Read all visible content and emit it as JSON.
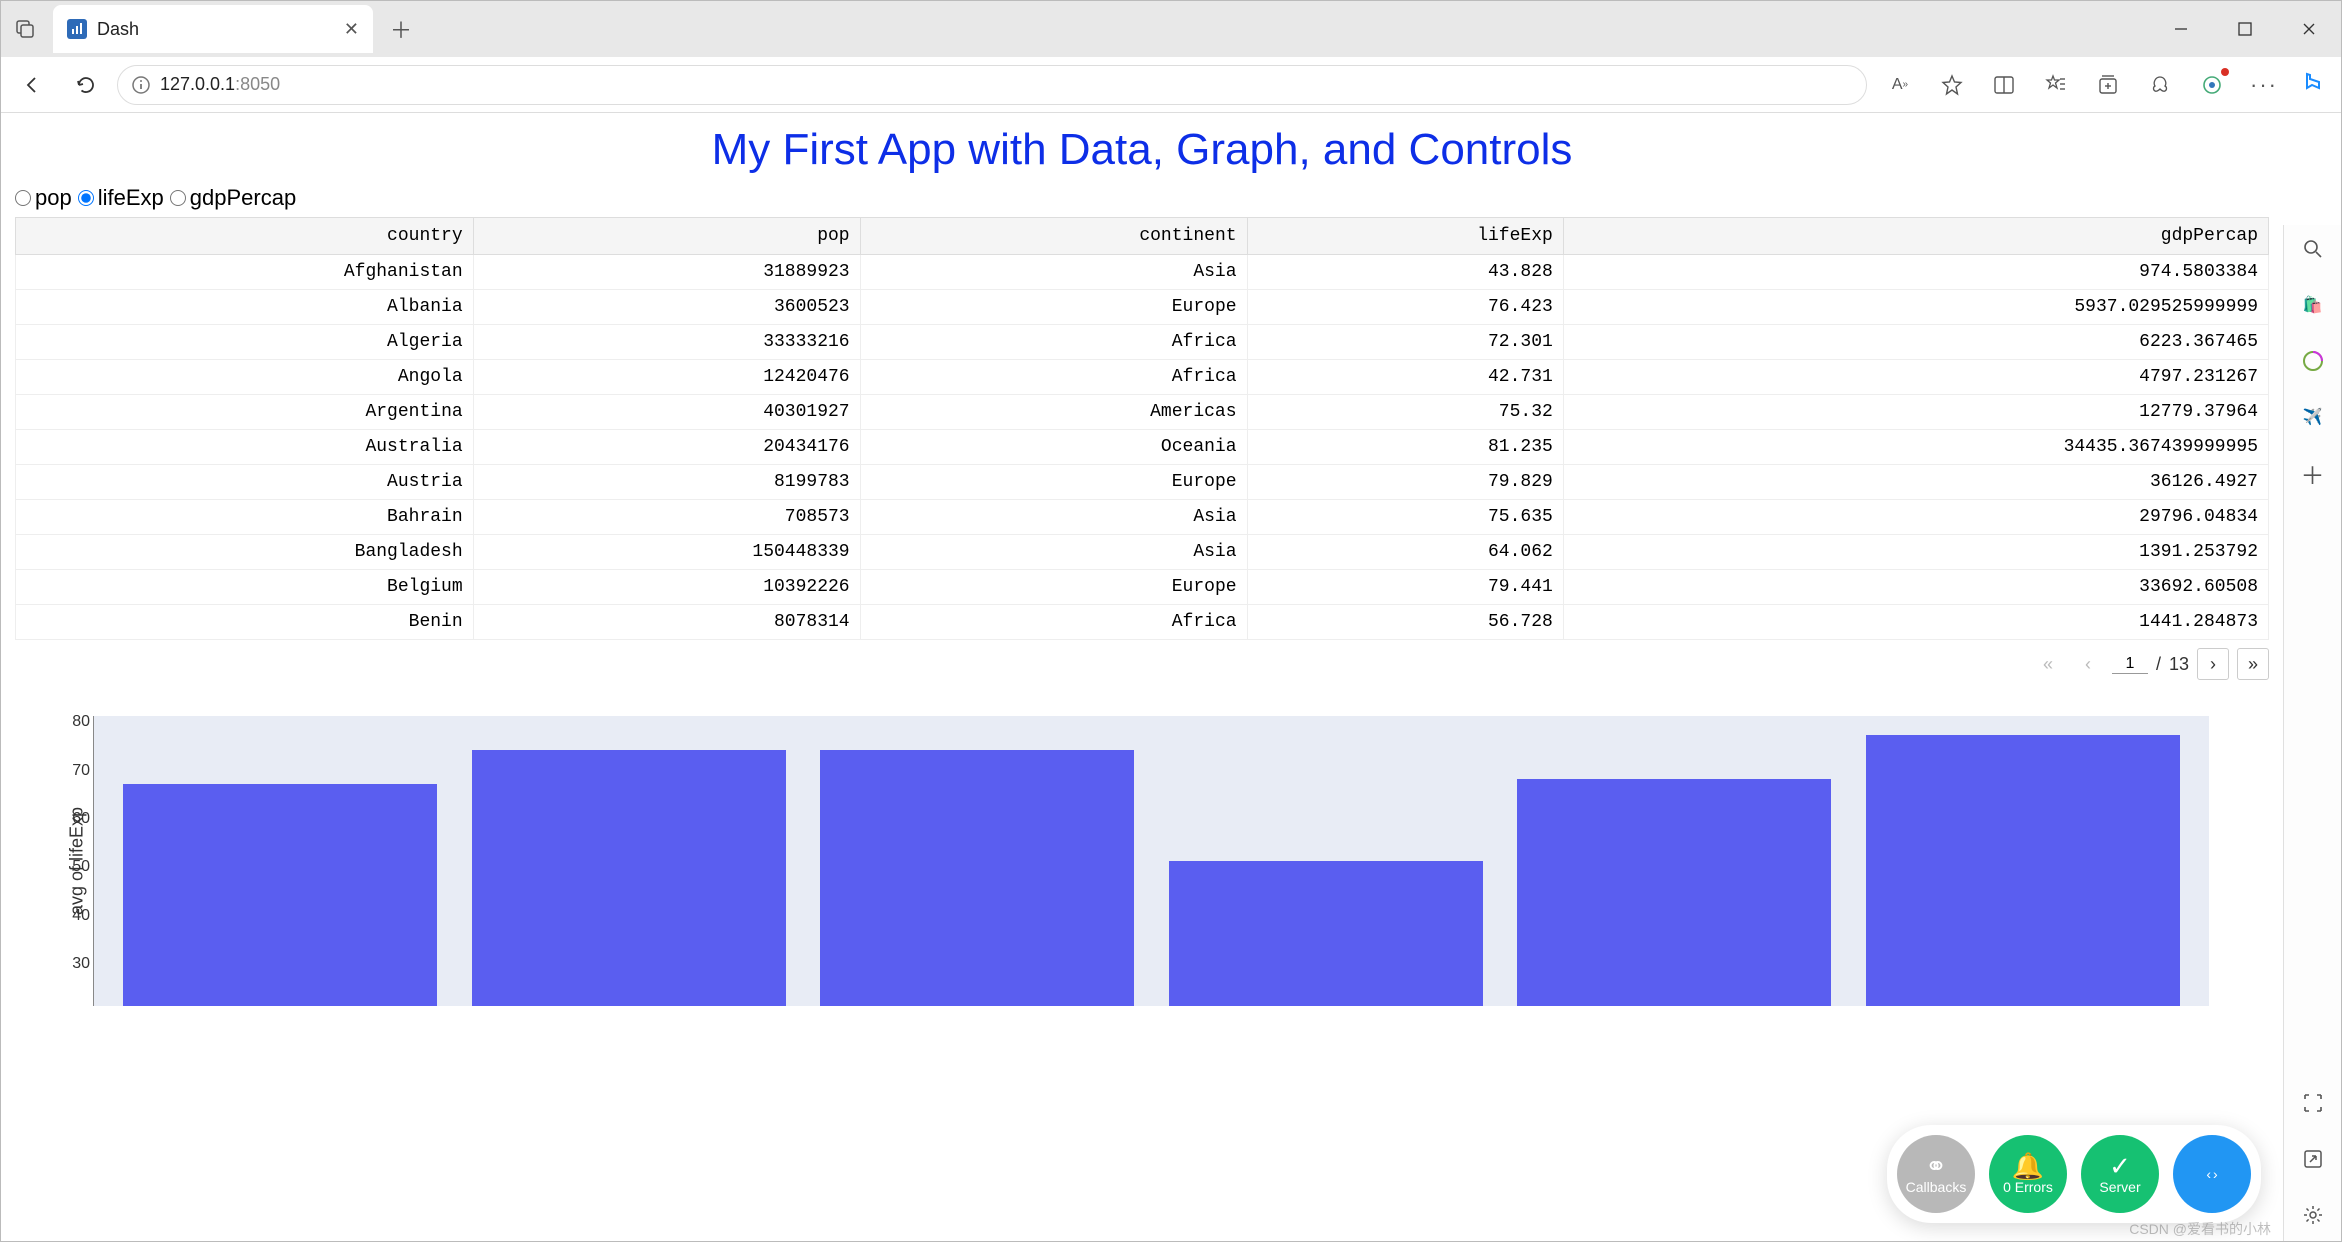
{
  "browser": {
    "tab_title": "Dash",
    "url_host": "127.0.0.1",
    "url_path": ":8050"
  },
  "page": {
    "title": "My First App with Data, Graph, and Controls",
    "radio_options": [
      {
        "label": "pop",
        "checked": false
      },
      {
        "label": "lifeExp",
        "checked": true
      },
      {
        "label": "gdpPercap",
        "checked": false
      }
    ],
    "table": {
      "columns": [
        "country",
        "pop",
        "continent",
        "lifeExp",
        "gdpPercap"
      ],
      "rows": [
        [
          "Afghanistan",
          "31889923",
          "Asia",
          "43.828",
          "974.5803384"
        ],
        [
          "Albania",
          "3600523",
          "Europe",
          "76.423",
          "5937.029525999999"
        ],
        [
          "Algeria",
          "33333216",
          "Africa",
          "72.301",
          "6223.367465"
        ],
        [
          "Angola",
          "12420476",
          "Africa",
          "42.731",
          "4797.231267"
        ],
        [
          "Argentina",
          "40301927",
          "Americas",
          "75.32",
          "12779.37964"
        ],
        [
          "Australia",
          "20434176",
          "Oceania",
          "81.235",
          "34435.367439999995"
        ],
        [
          "Austria",
          "8199783",
          "Europe",
          "79.829",
          "36126.4927"
        ],
        [
          "Bahrain",
          "708573",
          "Asia",
          "75.635",
          "29796.04834"
        ],
        [
          "Bangladesh",
          "150448339",
          "Asia",
          "64.062",
          "1391.253792"
        ],
        [
          "Belgium",
          "10392226",
          "Europe",
          "79.441",
          "33692.60508"
        ],
        [
          "Benin",
          "8078314",
          "Africa",
          "56.728",
          "1441.284873"
        ]
      ]
    },
    "paginator": {
      "current": "1",
      "sep": "/",
      "total": "13"
    },
    "dash_tools": {
      "callbacks": "Callbacks",
      "errors": "0 Errors",
      "server": "Server"
    },
    "watermark": "CSDN @爱看书的小林"
  },
  "chart_data": {
    "type": "bar",
    "ylabel": "avg of lifeExp",
    "ylim": [
      25,
      85
    ],
    "yticks": [
      30,
      40,
      50,
      60,
      70,
      80
    ],
    "categories": [
      "",
      "",
      "",
      "",
      "",
      ""
    ],
    "values": [
      71,
      78,
      78,
      55,
      72,
      81
    ]
  }
}
